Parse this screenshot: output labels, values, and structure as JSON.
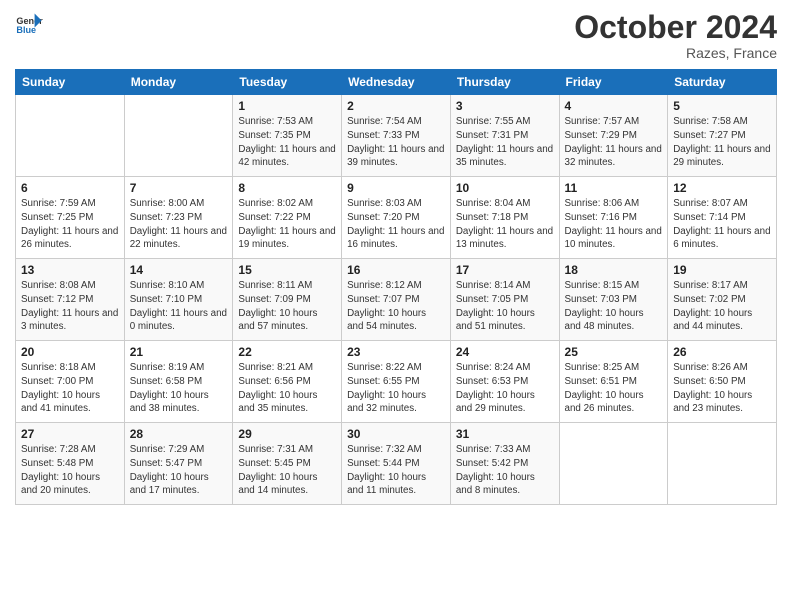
{
  "logo": {
    "line1": "General",
    "line2": "Blue"
  },
  "title": "October 2024",
  "location": "Razes, France",
  "days_header": [
    "Sunday",
    "Monday",
    "Tuesday",
    "Wednesday",
    "Thursday",
    "Friday",
    "Saturday"
  ],
  "weeks": [
    [
      {
        "day": "",
        "sunrise": "",
        "sunset": "",
        "daylight": ""
      },
      {
        "day": "",
        "sunrise": "",
        "sunset": "",
        "daylight": ""
      },
      {
        "day": "1",
        "sunrise": "Sunrise: 7:53 AM",
        "sunset": "Sunset: 7:35 PM",
        "daylight": "Daylight: 11 hours and 42 minutes."
      },
      {
        "day": "2",
        "sunrise": "Sunrise: 7:54 AM",
        "sunset": "Sunset: 7:33 PM",
        "daylight": "Daylight: 11 hours and 39 minutes."
      },
      {
        "day": "3",
        "sunrise": "Sunrise: 7:55 AM",
        "sunset": "Sunset: 7:31 PM",
        "daylight": "Daylight: 11 hours and 35 minutes."
      },
      {
        "day": "4",
        "sunrise": "Sunrise: 7:57 AM",
        "sunset": "Sunset: 7:29 PM",
        "daylight": "Daylight: 11 hours and 32 minutes."
      },
      {
        "day": "5",
        "sunrise": "Sunrise: 7:58 AM",
        "sunset": "Sunset: 7:27 PM",
        "daylight": "Daylight: 11 hours and 29 minutes."
      }
    ],
    [
      {
        "day": "6",
        "sunrise": "Sunrise: 7:59 AM",
        "sunset": "Sunset: 7:25 PM",
        "daylight": "Daylight: 11 hours and 26 minutes."
      },
      {
        "day": "7",
        "sunrise": "Sunrise: 8:00 AM",
        "sunset": "Sunset: 7:23 PM",
        "daylight": "Daylight: 11 hours and 22 minutes."
      },
      {
        "day": "8",
        "sunrise": "Sunrise: 8:02 AM",
        "sunset": "Sunset: 7:22 PM",
        "daylight": "Daylight: 11 hours and 19 minutes."
      },
      {
        "day": "9",
        "sunrise": "Sunrise: 8:03 AM",
        "sunset": "Sunset: 7:20 PM",
        "daylight": "Daylight: 11 hours and 16 minutes."
      },
      {
        "day": "10",
        "sunrise": "Sunrise: 8:04 AM",
        "sunset": "Sunset: 7:18 PM",
        "daylight": "Daylight: 11 hours and 13 minutes."
      },
      {
        "day": "11",
        "sunrise": "Sunrise: 8:06 AM",
        "sunset": "Sunset: 7:16 PM",
        "daylight": "Daylight: 11 hours and 10 minutes."
      },
      {
        "day": "12",
        "sunrise": "Sunrise: 8:07 AM",
        "sunset": "Sunset: 7:14 PM",
        "daylight": "Daylight: 11 hours and 6 minutes."
      }
    ],
    [
      {
        "day": "13",
        "sunrise": "Sunrise: 8:08 AM",
        "sunset": "Sunset: 7:12 PM",
        "daylight": "Daylight: 11 hours and 3 minutes."
      },
      {
        "day": "14",
        "sunrise": "Sunrise: 8:10 AM",
        "sunset": "Sunset: 7:10 PM",
        "daylight": "Daylight: 11 hours and 0 minutes."
      },
      {
        "day": "15",
        "sunrise": "Sunrise: 8:11 AM",
        "sunset": "Sunset: 7:09 PM",
        "daylight": "Daylight: 10 hours and 57 minutes."
      },
      {
        "day": "16",
        "sunrise": "Sunrise: 8:12 AM",
        "sunset": "Sunset: 7:07 PM",
        "daylight": "Daylight: 10 hours and 54 minutes."
      },
      {
        "day": "17",
        "sunrise": "Sunrise: 8:14 AM",
        "sunset": "Sunset: 7:05 PM",
        "daylight": "Daylight: 10 hours and 51 minutes."
      },
      {
        "day": "18",
        "sunrise": "Sunrise: 8:15 AM",
        "sunset": "Sunset: 7:03 PM",
        "daylight": "Daylight: 10 hours and 48 minutes."
      },
      {
        "day": "19",
        "sunrise": "Sunrise: 8:17 AM",
        "sunset": "Sunset: 7:02 PM",
        "daylight": "Daylight: 10 hours and 44 minutes."
      }
    ],
    [
      {
        "day": "20",
        "sunrise": "Sunrise: 8:18 AM",
        "sunset": "Sunset: 7:00 PM",
        "daylight": "Daylight: 10 hours and 41 minutes."
      },
      {
        "day": "21",
        "sunrise": "Sunrise: 8:19 AM",
        "sunset": "Sunset: 6:58 PM",
        "daylight": "Daylight: 10 hours and 38 minutes."
      },
      {
        "day": "22",
        "sunrise": "Sunrise: 8:21 AM",
        "sunset": "Sunset: 6:56 PM",
        "daylight": "Daylight: 10 hours and 35 minutes."
      },
      {
        "day": "23",
        "sunrise": "Sunrise: 8:22 AM",
        "sunset": "Sunset: 6:55 PM",
        "daylight": "Daylight: 10 hours and 32 minutes."
      },
      {
        "day": "24",
        "sunrise": "Sunrise: 8:24 AM",
        "sunset": "Sunset: 6:53 PM",
        "daylight": "Daylight: 10 hours and 29 minutes."
      },
      {
        "day": "25",
        "sunrise": "Sunrise: 8:25 AM",
        "sunset": "Sunset: 6:51 PM",
        "daylight": "Daylight: 10 hours and 26 minutes."
      },
      {
        "day": "26",
        "sunrise": "Sunrise: 8:26 AM",
        "sunset": "Sunset: 6:50 PM",
        "daylight": "Daylight: 10 hours and 23 minutes."
      }
    ],
    [
      {
        "day": "27",
        "sunrise": "Sunrise: 7:28 AM",
        "sunset": "Sunset: 5:48 PM",
        "daylight": "Daylight: 10 hours and 20 minutes."
      },
      {
        "day": "28",
        "sunrise": "Sunrise: 7:29 AM",
        "sunset": "Sunset: 5:47 PM",
        "daylight": "Daylight: 10 hours and 17 minutes."
      },
      {
        "day": "29",
        "sunrise": "Sunrise: 7:31 AM",
        "sunset": "Sunset: 5:45 PM",
        "daylight": "Daylight: 10 hours and 14 minutes."
      },
      {
        "day": "30",
        "sunrise": "Sunrise: 7:32 AM",
        "sunset": "Sunset: 5:44 PM",
        "daylight": "Daylight: 10 hours and 11 minutes."
      },
      {
        "day": "31",
        "sunrise": "Sunrise: 7:33 AM",
        "sunset": "Sunset: 5:42 PM",
        "daylight": "Daylight: 10 hours and 8 minutes."
      },
      {
        "day": "",
        "sunrise": "",
        "sunset": "",
        "daylight": ""
      },
      {
        "day": "",
        "sunrise": "",
        "sunset": "",
        "daylight": ""
      }
    ]
  ]
}
